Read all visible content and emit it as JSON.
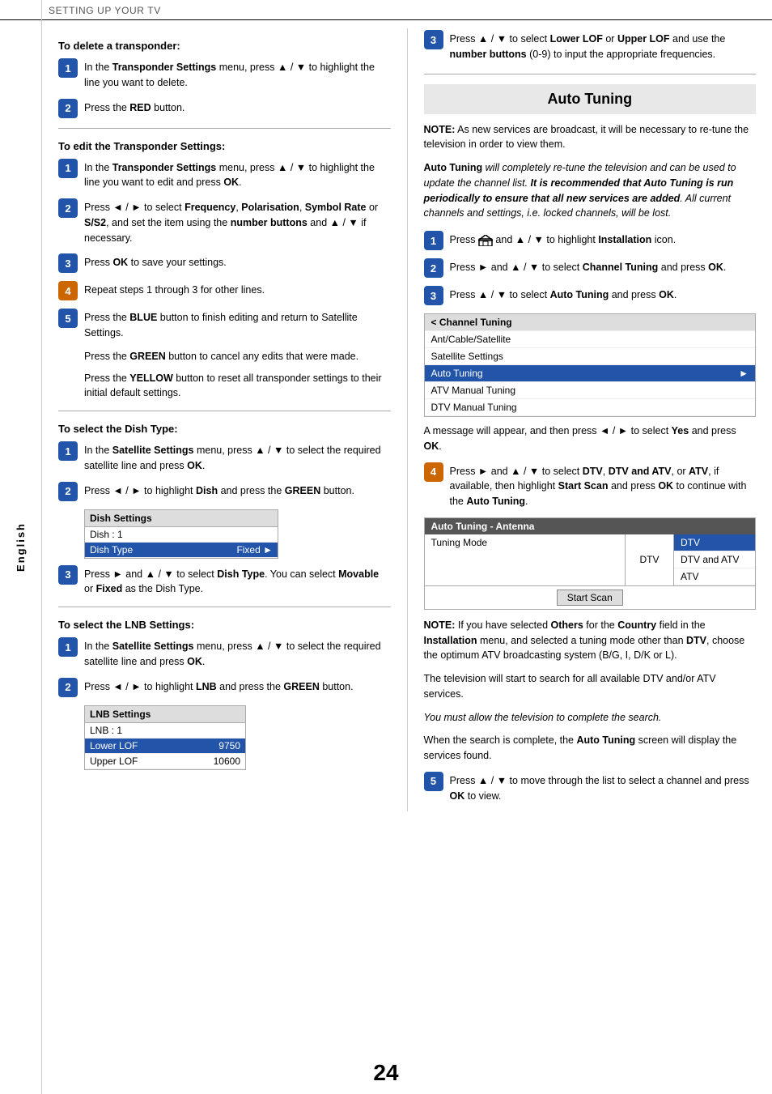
{
  "header": {
    "title": "SETTING UP YOUR TV"
  },
  "sidebar": {
    "label": "English"
  },
  "page_number": "24",
  "left_column": {
    "delete_transponder": {
      "heading": "To delete a transponder:",
      "steps": [
        {
          "num": "1",
          "text": "In the <b>Transponder Settings</b> menu, press ▲ / ▼ to highlight the line you want to delete."
        },
        {
          "num": "2",
          "text": "Press the <b>RED</b> button."
        }
      ]
    },
    "edit_transponder": {
      "heading": "To edit the Transponder Settings:",
      "steps": [
        {
          "num": "1",
          "text": "In the <b>Transponder Settings</b> menu, press ▲ / ▼ to highlight the line you want to edit and press <b>OK</b>."
        },
        {
          "num": "2",
          "text": "Press ◄ / ► to select <b>Frequency</b>, <b>Polarisation</b>, <b>Symbol Rate</b> or <b>S/S2</b>, and set the item using the <b>number buttons</b> and ▲ / ▼ if necessary."
        },
        {
          "num": "3",
          "text": "Press <b>OK</b> to save your settings."
        },
        {
          "num": "4",
          "text": "Repeat steps 1 through 3 for other lines."
        },
        {
          "num": "5",
          "text": "Press the <b>BLUE</b> button to finish editing and return to Satellite Settings."
        }
      ],
      "plain_paras": [
        "Press the <b>GREEN</b> button to cancel any edits that were made.",
        "Press the <b>YELLOW</b> button to reset all transponder settings to their initial default settings."
      ]
    },
    "dish_type": {
      "heading": "To select the Dish Type:",
      "steps": [
        {
          "num": "1",
          "text": "In the <b>Satellite Settings</b> menu, press ▲ / ▼ to select the required satellite line and press <b>OK</b>."
        },
        {
          "num": "2",
          "text": "Press ◄ / ► to highlight <b>Dish</b> and press the <b>GREEN</b> button."
        }
      ],
      "menu": {
        "header": "Dish Settings",
        "rows": [
          {
            "label": "Dish : 1",
            "value": "",
            "highlighted": false
          },
          {
            "label": "Dish Type",
            "value": "Fixed",
            "highlighted": true
          }
        ]
      },
      "step3": {
        "num": "3",
        "text": "Press ► and ▲ / ▼ to select <b>Dish Type</b>. You can select <b>Movable</b> or <b>Fixed</b> as the Dish Type."
      }
    },
    "lnb_settings": {
      "heading": "To select the LNB Settings:",
      "steps": [
        {
          "num": "1",
          "text": "In the <b>Satellite Settings</b> menu, press ▲ / ▼ to select the required satellite line and press <b>OK</b>."
        },
        {
          "num": "2",
          "text": "Press ◄ / ► to highlight <b>LNB</b> and press the <b>GREEN</b> button."
        }
      ],
      "lnb_menu": {
        "header": "LNB Settings",
        "rows": [
          {
            "label": "LNB : 1",
            "value": "",
            "highlighted": false
          },
          {
            "label": "Lower LOF",
            "value": "9750",
            "highlighted": true
          },
          {
            "label": "Upper LOF",
            "value": "10600",
            "highlighted": false
          }
        ]
      }
    }
  },
  "right_column": {
    "lnb_step3": {
      "num": "3",
      "text": "Press ▲ / ▼ to select <b>Lower LOF</b> or <b>Upper LOF</b> and use the <b>number buttons</b> (0-9) to input the appropriate frequencies."
    },
    "auto_tuning": {
      "heading": "Auto Tuning",
      "note_intro": "<b>NOTE:</b> As new services are broadcast, it will be necessary to re-tune the television in order to view them.",
      "note_body": "<b>Auto Tuning</b> <i>will completely re-tune the television and can be used to update the channel list. <b>It is recommended that Auto Tuning is run periodically to ensure that all new services are added</b>. All current channels and settings, i.e. locked channels, will be lost.</i>",
      "steps": [
        {
          "num": "1",
          "text": "Press [home] and ▲ / ▼ to highlight <b>Installation</b> icon."
        },
        {
          "num": "2",
          "text": "Press ► and ▲ / ▼ to select <b>Channel Tuning</b> and press <b>OK</b>."
        },
        {
          "num": "3",
          "text": "Press ▲ / ▼ to select <b>Auto Tuning</b> and press <b>OK</b>."
        }
      ],
      "channel_menu": {
        "header_row": "< Channel Tuning",
        "rows": [
          {
            "label": "Ant/Cable/Satellite",
            "highlighted": false
          },
          {
            "label": "Satellite Settings",
            "highlighted": false
          },
          {
            "label": "Auto Tuning",
            "highlighted": true
          },
          {
            "label": "ATV Manual Tuning",
            "highlighted": false
          },
          {
            "label": "DTV Manual Tuning",
            "highlighted": false
          }
        ]
      },
      "after_menu_text": "A message will appear, and then press ◄ / ► to select <b>Yes</b> and press <b>OK</b>.",
      "step4": {
        "num": "4",
        "text": "Press ► and ▲ / ▼ to select <b>DTV</b>, <b>DTV and ATV</b>, or <b>ATV</b>, if available, then highlight <b>Start Scan</b> and press <b>OK</b> to continue with the <b>Auto Tuning</b>."
      },
      "at_table": {
        "header": "Auto Tuning - Antenna",
        "left_col": "Tuning Mode",
        "right_opts": [
          {
            "label": "DTV",
            "header_label": "DTV",
            "highlighted": true
          },
          {
            "label": "DTV and ATV",
            "highlighted": false
          },
          {
            "label": "ATV",
            "highlighted": false
          }
        ],
        "scan_btn": "Start Scan"
      },
      "note1": "<b>NOTE:</b> If you have selected <b>Others</b> for the <b>Country</b> field in the <b>Installation</b> menu, and selected a tuning mode other than <b>DTV</b>, choose the optimum ATV broadcasting system (B/G, I, D/K or L).",
      "note2": "The television will start to search for all available DTV and/or ATV services.",
      "note3": "<i>You must allow the television to complete the search.</i>",
      "note4": "When the search is complete, the <b>Auto Tuning</b> screen will display the services found.",
      "step5": {
        "num": "5",
        "text": "Press ▲ / ▼ to move through the list to select a channel and press <b>OK</b> to view."
      }
    }
  }
}
